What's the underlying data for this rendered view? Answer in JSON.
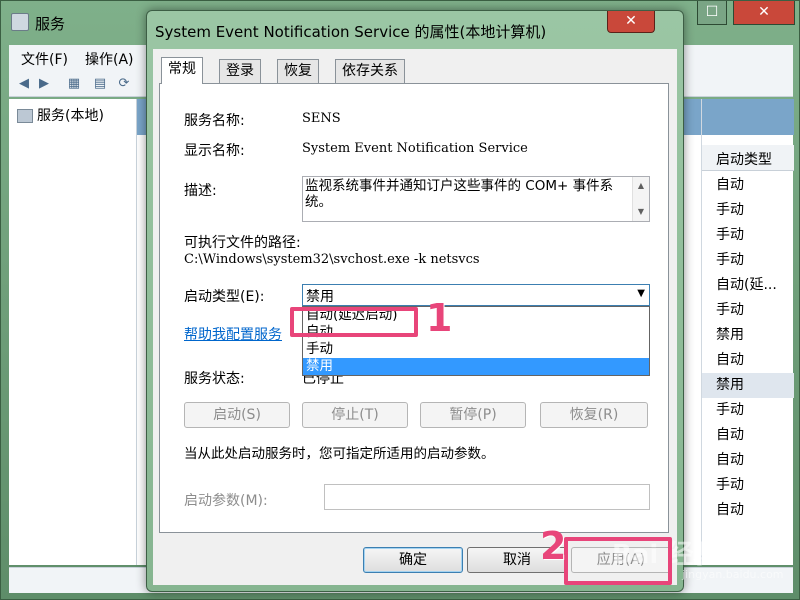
{
  "background_window": {
    "title": "服务",
    "menu": [
      "文件(F)",
      "操作(A)"
    ],
    "tree_root": "服务(本地)",
    "column_header": "启动类型",
    "startup_types": [
      "自动",
      "手动",
      "手动",
      "手动",
      "自动(延...",
      "手动",
      "禁用",
      "自动",
      "禁用",
      "手动",
      "自动",
      "自动",
      "手动",
      "自动"
    ],
    "close_glyph": "✕",
    "max_glyph": "☐"
  },
  "dialog": {
    "title": "System Event Notification Service 的属性(本地计算机)",
    "close_glyph": "✕",
    "tabs": [
      {
        "label": "常规",
        "active": true
      },
      {
        "label": "登录",
        "active": false
      },
      {
        "label": "恢复",
        "active": false
      },
      {
        "label": "依存关系",
        "active": false
      }
    ],
    "service_name_label": "服务名称:",
    "service_name_value": "SENS",
    "display_name_label": "显示名称:",
    "display_name_value": "System Event Notification Service",
    "description_label": "描述:",
    "description_value": "监视系统事件并通知订户这些事件的 COM+ 事件系统。",
    "exe_path_label": "可执行文件的路径:",
    "exe_path_value": "C:\\Windows\\system32\\svchost.exe -k netsvcs",
    "startup_type_label": "启动类型(E):",
    "startup_type_value": "禁用",
    "startup_options": [
      "自动(延迟启动)",
      "自动",
      "手动",
      "禁用"
    ],
    "startup_selected_index": 3,
    "help_link": "帮助我配置服务",
    "status_label": "服务状态:",
    "status_value": "已停止",
    "buttons": {
      "start": "启动(S)",
      "stop": "停止(T)",
      "pause": "暂停(P)",
      "resume": "恢复(R)"
    },
    "hint_text": "当从此处启动服务时，您可指定所适用的启动参数。",
    "param_label": "启动参数(M):",
    "param_value": "",
    "ok": "确定",
    "cancel": "取消",
    "apply": "应用(A)"
  },
  "annotations": {
    "step1": "1",
    "step2": "2",
    "color": "#e8457a"
  },
  "watermark": {
    "text": "Bai 经验",
    "sub": "jingyan.baidu.com"
  }
}
